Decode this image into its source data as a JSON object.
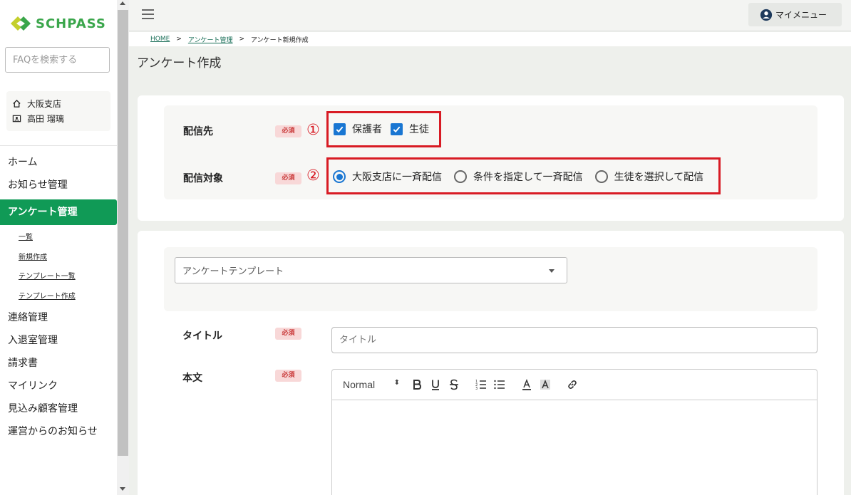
{
  "brand": {
    "name": "SCHPASS",
    "color": "#3aa64b"
  },
  "sidebar": {
    "faq_placeholder": "FAQを検索する",
    "branch": "大阪支店",
    "user_name": "高田 瑠璃",
    "nav": {
      "home": "ホーム",
      "notice": "お知らせ管理",
      "survey": "アンケート管理",
      "contact": "連絡管理",
      "entry": "入退室管理",
      "invoice": "請求書",
      "mylink": "マイリンク",
      "prospect": "見込み顧客管理",
      "ops_notice": "運営からのお知らせ"
    },
    "sub": {
      "list": "一覧",
      "new": "新規作成",
      "template_list": "テンプレート一覧",
      "template_new": "テンプレート作成"
    },
    "active_color": "#109a56"
  },
  "topbar": {
    "mymenu_label": "マイメニュー"
  },
  "breadcrumb": {
    "home": "HOME",
    "survey": "アンケート管理",
    "current": "アンケート新規作成",
    "sep": ">"
  },
  "page_title": "アンケート作成",
  "delivery": {
    "dest_label": "配信先",
    "target_label": "配信対象",
    "required": "必須",
    "num1": "①",
    "num2": "②",
    "dest_options": [
      "保護者",
      "生徒"
    ],
    "dest_checked": [
      true,
      true
    ],
    "target_options": [
      "大阪支店に一斉配信",
      "条件を指定して一斉配信",
      "生徒を選択して配信"
    ],
    "target_selected": 0
  },
  "form": {
    "template_placeholder": "アンケートテンプレート",
    "title_label": "タイトル",
    "title_placeholder": "タイトル",
    "body_label": "本文",
    "required": "必須",
    "toolbar_format": "Normal",
    "toolbar_format_arrow": "⬍"
  },
  "colors": {
    "highlight": "#d81b24",
    "checkbox": "#1976d2"
  }
}
